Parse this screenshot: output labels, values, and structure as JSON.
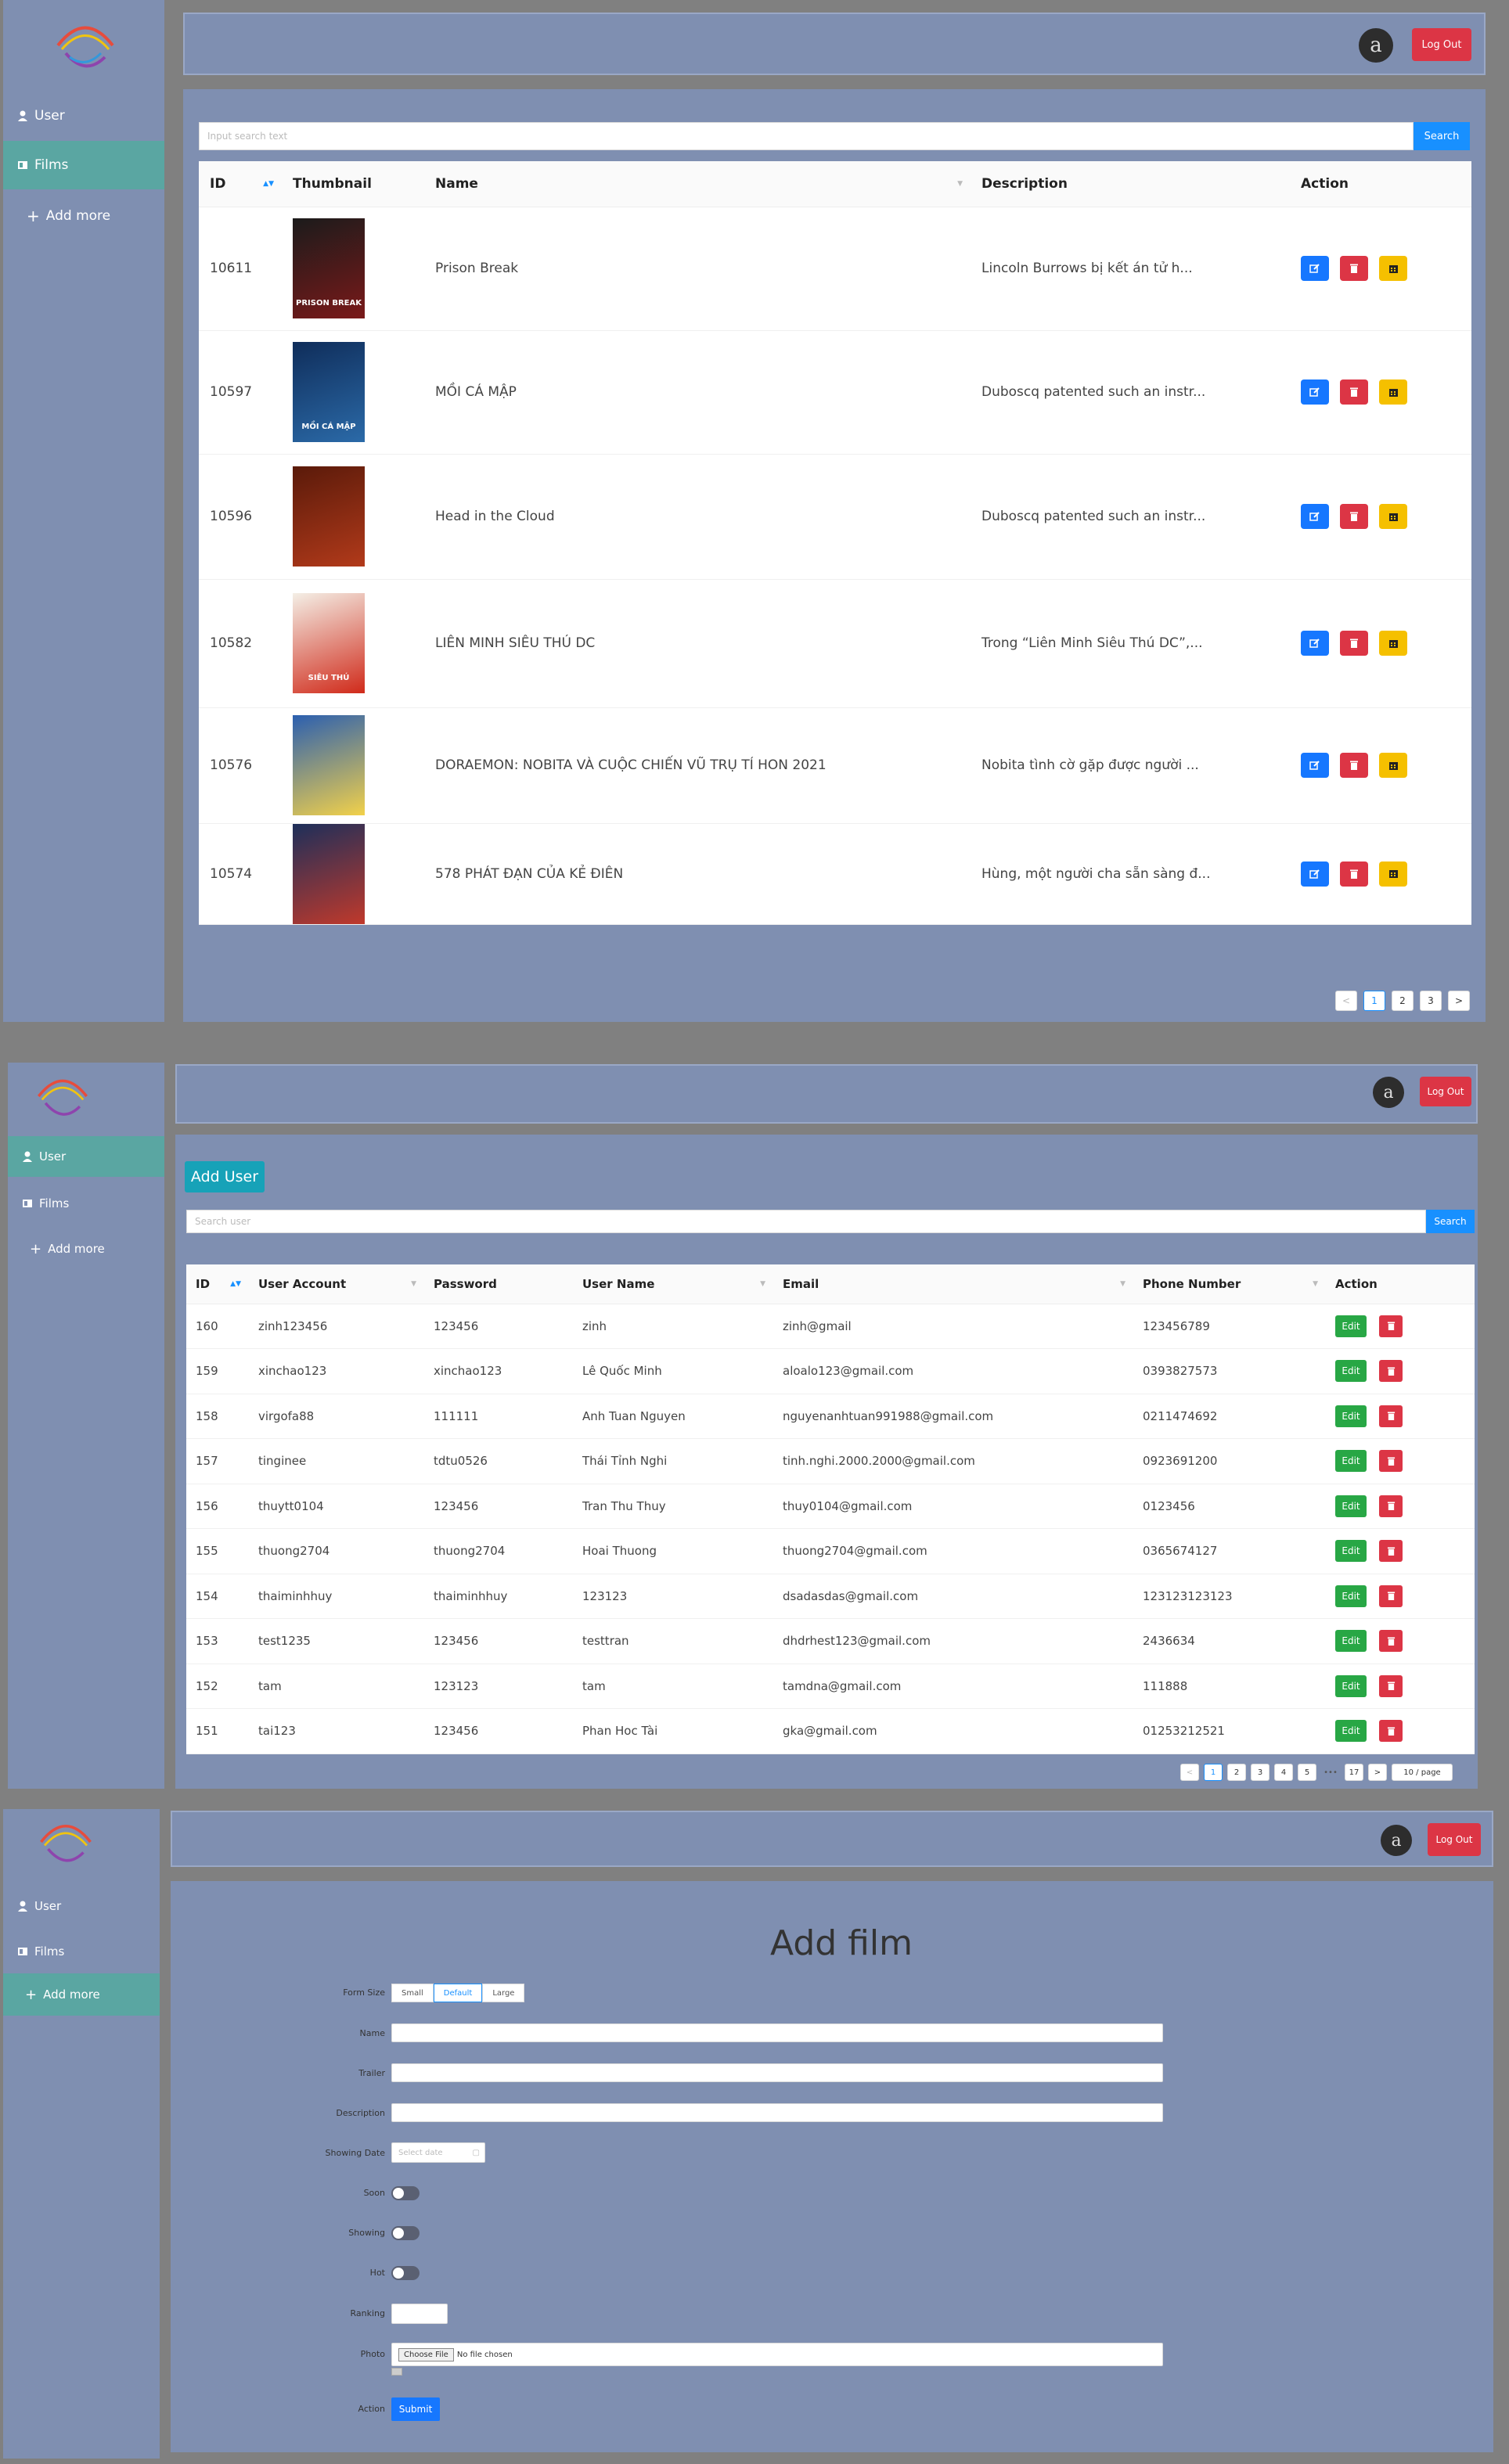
{
  "sidebar": {
    "user_label": "User",
    "films_label": "Films",
    "add_more_label": "Add more"
  },
  "header": {
    "avatar_letter": "a",
    "logout_label": "Log Out"
  },
  "films": {
    "search_placeholder": "Input search text",
    "search_label": "Search",
    "columns": [
      "ID",
      "Thumbnail",
      "Name",
      "Description",
      "Action"
    ],
    "rows": [
      {
        "id": "10611",
        "name": "Prison Break",
        "description": "Lincoln Burrows bị kết án tử h...",
        "thumb_label": "PRISON BREAK"
      },
      {
        "id": "10597",
        "name": "MỒI CÁ MẬP",
        "description": "Duboscq patented such an instr...",
        "thumb_label": "MỒI CÁ MẬP"
      },
      {
        "id": "10596",
        "name": "Head in the Cloud",
        "description": "Duboscq patented such an instr...",
        "thumb_label": ""
      },
      {
        "id": "10582",
        "name": "LIÊN MINH SIÊU THÚ DC",
        "description": "Trong “Liên Minh Siêu Thú DC”,...",
        "thumb_label": "SIÊU THÚ"
      },
      {
        "id": "10576",
        "name": "DORAEMON: NOBITA VÀ CUỘC CHIẾN VŨ TRỤ TÍ HON 2021",
        "description": "Nobita tình cờ gặp được người ...",
        "thumb_label": ""
      },
      {
        "id": "10574",
        "name": "578 PHÁT ĐẠN CỦA KẺ ĐIÊN",
        "description": "Hùng, một người cha sẵn sàng đ...",
        "thumb_label": ""
      }
    ],
    "pager": [
      "<",
      "1",
      "2",
      "3",
      ">"
    ]
  },
  "users": {
    "add_user_label": "Add User",
    "search_placeholder": "Search user",
    "search_label": "Search",
    "columns": [
      "ID",
      "User Account",
      "Password",
      "User Name",
      "Email",
      "Phone Number",
      "Action"
    ],
    "rows": [
      {
        "id": "160",
        "account": "zinh123456",
        "password": "123456",
        "name": "zinh",
        "email": "zinh@gmail",
        "phone": "123456789"
      },
      {
        "id": "159",
        "account": "xinchao123",
        "password": "xinchao123",
        "name": "Lê Quốc Minh",
        "email": "aloalo123@gmail.com",
        "phone": "0393827573"
      },
      {
        "id": "158",
        "account": "virgofa88",
        "password": "111111",
        "name": "Anh Tuan Nguyen",
        "email": "nguyenanhtuan991988@gmail.com",
        "phone": "0211474692"
      },
      {
        "id": "157",
        "account": "tinginee",
        "password": "tdtu0526",
        "name": "Thái Tỉnh Nghi",
        "email": "tinh.nghi.2000.2000@gmail.com",
        "phone": "0923691200"
      },
      {
        "id": "156",
        "account": "thuytt0104",
        "password": "123456",
        "name": "Tran Thu Thuy",
        "email": "thuy0104@gmail.com",
        "phone": "0123456"
      },
      {
        "id": "155",
        "account": "thuong2704",
        "password": "thuong2704",
        "name": "Hoai Thuong",
        "email": "thuong2704@gmail.com",
        "phone": "0365674127"
      },
      {
        "id": "154",
        "account": "thaiminhhuy",
        "password": "thaiminhhuy",
        "name": "123123",
        "email": "dsadasdas@gmail.com",
        "phone": "123123123123"
      },
      {
        "id": "153",
        "account": "test1235",
        "password": "123456",
        "name": "testtran",
        "email": "dhdrhest123@gmail.com",
        "phone": "2436634"
      },
      {
        "id": "152",
        "account": "tam",
        "password": "123123",
        "name": "tam",
        "email": "tamdna@gmail.com",
        "phone": "111888"
      },
      {
        "id": "151",
        "account": "tai123",
        "password": "123456",
        "name": "Phan Hoc Tài",
        "email": "gka@gmail.com",
        "phone": "01253212521"
      }
    ],
    "edit_label": "Edit",
    "pager": [
      "<",
      "1",
      "2",
      "3",
      "4",
      "5",
      "•••",
      "17",
      ">"
    ],
    "page_size": "10 / page"
  },
  "add_film": {
    "title": "Add film",
    "form_size_label": "Form Size",
    "sizes": [
      "Small",
      "Default",
      "Large"
    ],
    "name_label": "Name",
    "trailer_label": "Trailer",
    "description_label": "Description",
    "showing_date_label": "Showing Date",
    "date_placeholder": "Select date",
    "soon_label": "Soon",
    "showing_label": "Showing",
    "hot_label": "Hot",
    "ranking_label": "Ranking",
    "photo_label": "Photo",
    "choose_file_label": "Choose File",
    "no_file_label": "No file chosen",
    "action_label": "Action",
    "submit_label": "Submit"
  }
}
